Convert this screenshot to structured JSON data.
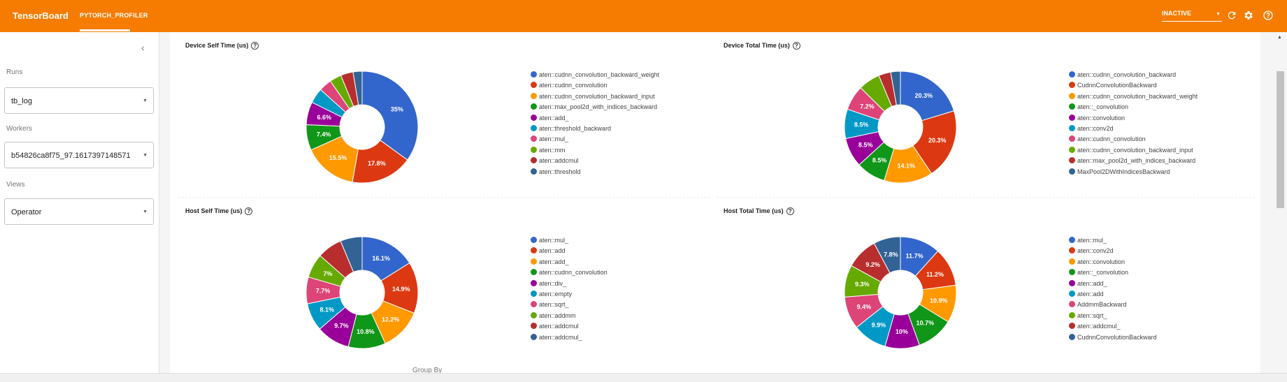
{
  "app": {
    "brand": "TensorBoard",
    "active_tab": "PYTORCH_PROFILER",
    "status": "INACTIVE"
  },
  "icons": {
    "refresh": "refresh-icon",
    "settings": "gear-icon",
    "help": "help-circle-icon",
    "collapse": "chevron-left-icon"
  },
  "sidebar": {
    "runs_label": "Runs",
    "runs_value": "tb_log",
    "workers_label": "Workers",
    "workers_value": "b54826ca8f75_97.1617397148571",
    "views_label": "Views",
    "views_value": "Operator"
  },
  "group_by_label": "Group By",
  "chart_data": [
    {
      "type": "pie",
      "donut": true,
      "title": "Device Self Time (us)",
      "labels": [
        "aten::cudnn_convolution_backward_weight",
        "aten::cudnn_convolution",
        "aten::cudnn_convolution_backward_input",
        "aten::max_pool2d_with_indices_backward",
        "aten::add_",
        "aten::threshold_backward",
        "aten::mul_",
        "aten::mm",
        "aten::addcmul",
        "aten::threshold"
      ],
      "values": [
        35.0,
        17.8,
        15.5,
        7.4,
        6.6,
        4.4,
        3.7,
        3.4,
        3.6,
        2.6
      ],
      "value_labels": [
        "35%",
        "17.8%",
        "15.5%",
        "7.4%",
        "6.6%",
        "",
        "",
        "",
        "",
        ""
      ],
      "colors": [
        "#3366cc",
        "#dc3912",
        "#ff9900",
        "#109618",
        "#990099",
        "#0099c6",
        "#dd4477",
        "#66aa00",
        "#b82e2e",
        "#316395"
      ],
      "legend": "right"
    },
    {
      "type": "pie",
      "donut": true,
      "title": "Device Total Time (us)",
      "labels": [
        "aten::cudnn_convolution_backward",
        "CudnnConvolutionBackward",
        "aten::cudnn_convolution_backward_weight",
        "aten::_convolution",
        "aten::convolution",
        "aten::conv2d",
        "aten::cudnn_convolution",
        "aten::cudnn_convolution_backward_input",
        "aten::max_pool2d_with_indices_backward",
        "MaxPool2DWithIndicesBackward"
      ],
      "values": [
        20.3,
        20.3,
        14.1,
        8.5,
        8.5,
        8.5,
        7.2,
        6.3,
        3.5,
        2.8
      ],
      "value_labels": [
        "20.3%",
        "20.3%",
        "14.1%",
        "8.5%",
        "8.5%",
        "8.5%",
        "7.2%",
        "",
        "",
        ""
      ],
      "colors": [
        "#3366cc",
        "#dc3912",
        "#ff9900",
        "#109618",
        "#990099",
        "#0099c6",
        "#dd4477",
        "#66aa00",
        "#b82e2e",
        "#316395"
      ],
      "legend": "right"
    },
    {
      "type": "pie",
      "donut": true,
      "title": "Host Self Time (us)",
      "labels": [
        "aten::mul_",
        "aten::add",
        "aten::add_",
        "aten::cudnn_convolution",
        "aten::div_",
        "aten::empty",
        "aten::sqrt_",
        "aten::addmm",
        "aten::addcmul",
        "aten::addcmul_"
      ],
      "values": [
        16.1,
        14.9,
        12.2,
        10.8,
        9.7,
        8.1,
        7.7,
        7.0,
        7.2,
        6.3
      ],
      "value_labels": [
        "16.1%",
        "14.9%",
        "12.2%",
        "10.8%",
        "9.7%",
        "8.1%",
        "7.7%",
        "7%",
        "",
        ""
      ],
      "colors": [
        "#3366cc",
        "#dc3912",
        "#ff9900",
        "#109618",
        "#990099",
        "#0099c6",
        "#dd4477",
        "#66aa00",
        "#b82e2e",
        "#316395"
      ],
      "legend": "right"
    },
    {
      "type": "pie",
      "donut": true,
      "title": "Host Total Time (us)",
      "labels": [
        "aten::mul_",
        "aten::conv2d",
        "aten::convolution",
        "aten::_convolution",
        "aten::add_",
        "aten::add",
        "AddmmBackward",
        "aten::sqrt_",
        "aten::addcmul_",
        "CudnnConvolutionBackward"
      ],
      "values": [
        11.7,
        11.2,
        10.9,
        10.7,
        10.0,
        9.9,
        9.4,
        9.3,
        9.2,
        7.8
      ],
      "value_labels": [
        "11.7%",
        "11.2%",
        "10.9%",
        "10.7%",
        "10%",
        "9.9%",
        "9.4%",
        "9.3%",
        "9.2%",
        "7.8%"
      ],
      "colors": [
        "#3366cc",
        "#dc3912",
        "#ff9900",
        "#109618",
        "#990099",
        "#0099c6",
        "#dd4477",
        "#66aa00",
        "#b82e2e",
        "#316395"
      ],
      "legend": "right"
    }
  ]
}
